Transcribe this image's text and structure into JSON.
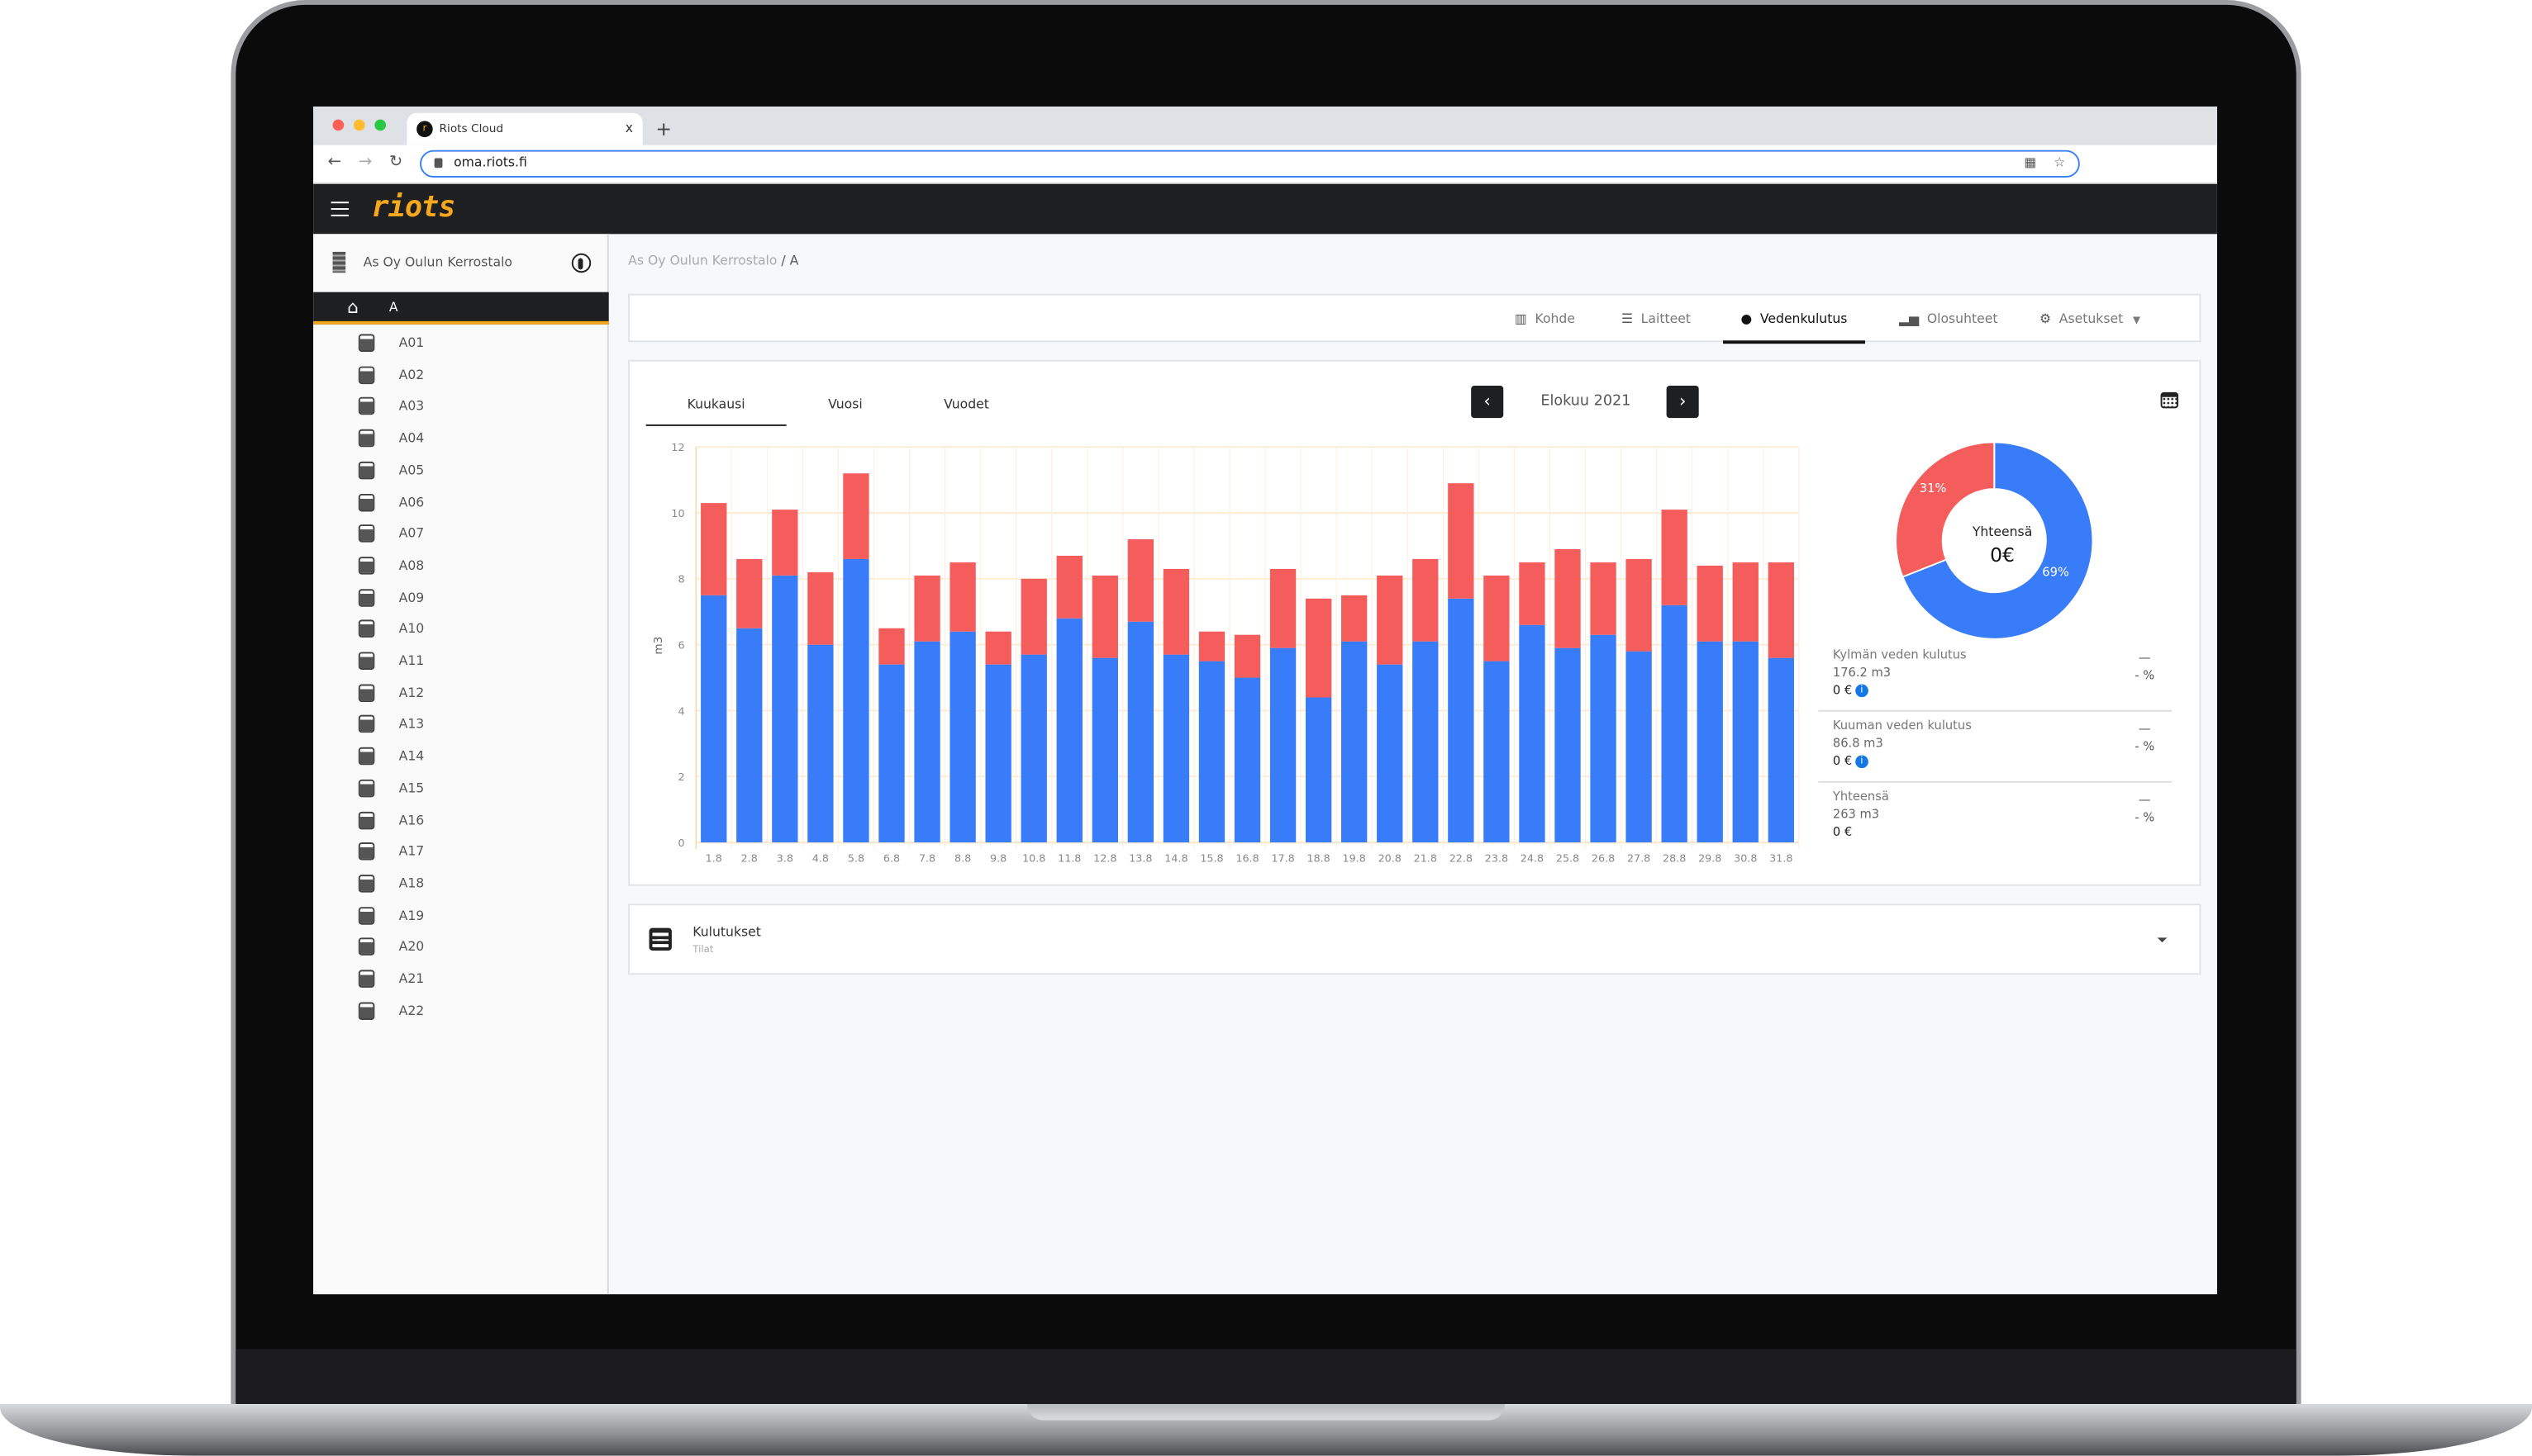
{
  "browser": {
    "tab_title": "Riots Cloud",
    "favicon_letter": "r",
    "url": "oma.riots.fi",
    "new_tab": "+",
    "close": "x"
  },
  "app": {
    "logo": "riots"
  },
  "sidebar": {
    "building": "As Oy Oulun Kerrostalo",
    "selected": "A",
    "items": [
      "A01",
      "A02",
      "A03",
      "A04",
      "A05",
      "A06",
      "A07",
      "A08",
      "A09",
      "A10",
      "A11",
      "A12",
      "A13",
      "A14",
      "A15",
      "A16",
      "A17",
      "A18",
      "A19",
      "A20",
      "A21",
      "A22"
    ]
  },
  "breadcrumb": {
    "parent": "As Oy Oulun Kerrostalo",
    "separator": " / ",
    "current": "A"
  },
  "nav": [
    {
      "label": "Kohde",
      "icon": "building-icon"
    },
    {
      "label": "Laitteet",
      "icon": "list-icon"
    },
    {
      "label": "Vedenkulutus",
      "icon": "water-drop-icon",
      "active": true
    },
    {
      "label": "Olosuhteet",
      "icon": "bar-chart-icon"
    },
    {
      "label": "Asetukset",
      "icon": "gear-icon"
    }
  ],
  "period_tabs": [
    {
      "label": "Kuukausi",
      "active": true
    },
    {
      "label": "Vuosi"
    },
    {
      "label": "Vuodet"
    }
  ],
  "period": "Elokuu 2021",
  "colors": {
    "cold": "#397cf9",
    "hot": "#f55d5d",
    "accent": "#f5a81c",
    "dark": "#1e1f21"
  },
  "chart_data": {
    "type": "bar",
    "stacked": true,
    "ylabel": "m3",
    "ylim": [
      0,
      12
    ],
    "yticks": [
      0,
      2,
      4,
      6,
      8,
      10,
      12
    ],
    "grid": true,
    "categories": [
      "1.8",
      "2.8",
      "3.8",
      "4.8",
      "5.8",
      "6.8",
      "7.8",
      "8.8",
      "9.8",
      "10.8",
      "11.8",
      "12.8",
      "13.8",
      "14.8",
      "15.8",
      "16.8",
      "17.8",
      "18.8",
      "19.8",
      "20.8",
      "21.8",
      "22.8",
      "23.8",
      "24.8",
      "25.8",
      "26.8",
      "27.8",
      "28.8",
      "29.8",
      "30.8",
      "31.8"
    ],
    "series": [
      {
        "key": "cold",
        "values": [
          7.5,
          6.5,
          8.1,
          6.0,
          8.6,
          5.4,
          6.1,
          6.4,
          5.4,
          5.7,
          6.8,
          5.6,
          6.7,
          5.7,
          5.5,
          5.0,
          5.9,
          4.4,
          6.1,
          5.4,
          6.1,
          7.4,
          5.5,
          6.6,
          5.9,
          6.3,
          5.8,
          7.2,
          6.1,
          6.1,
          5.6
        ]
      },
      {
        "key": "hot",
        "values": [
          2.8,
          2.1,
          2.0,
          2.2,
          2.6,
          1.1,
          2.0,
          2.1,
          1.0,
          2.3,
          1.9,
          2.5,
          2.5,
          2.6,
          0.9,
          1.3,
          2.4,
          3.0,
          1.4,
          2.7,
          2.5,
          3.5,
          2.6,
          1.9,
          3.0,
          2.2,
          2.8,
          2.9,
          2.3,
          2.4,
          2.9
        ]
      }
    ]
  },
  "donut": {
    "center_title": "Yhteensä",
    "center_value": "0€",
    "slices": [
      {
        "key": "cold",
        "percent": 69,
        "label": "69%"
      },
      {
        "key": "hot",
        "percent": 31,
        "label": "31%"
      }
    ]
  },
  "summary": [
    {
      "title": "Kylmän veden kulutus",
      "volume": "176.2 m3",
      "cost": "0 €",
      "info": true,
      "trend": "—",
      "percent": "- %"
    },
    {
      "title": "Kuuman veden kulutus",
      "volume": "86.8 m3",
      "cost": "0 €",
      "info": true,
      "trend": "—",
      "percent": "- %"
    },
    {
      "title": "Yhteensä",
      "volume": "263 m3",
      "cost": "0 €",
      "info": false,
      "trend": "—",
      "percent": "- %"
    }
  ],
  "consumption_panel": {
    "title": "Kulutukset",
    "subtitle": "Tilat"
  }
}
